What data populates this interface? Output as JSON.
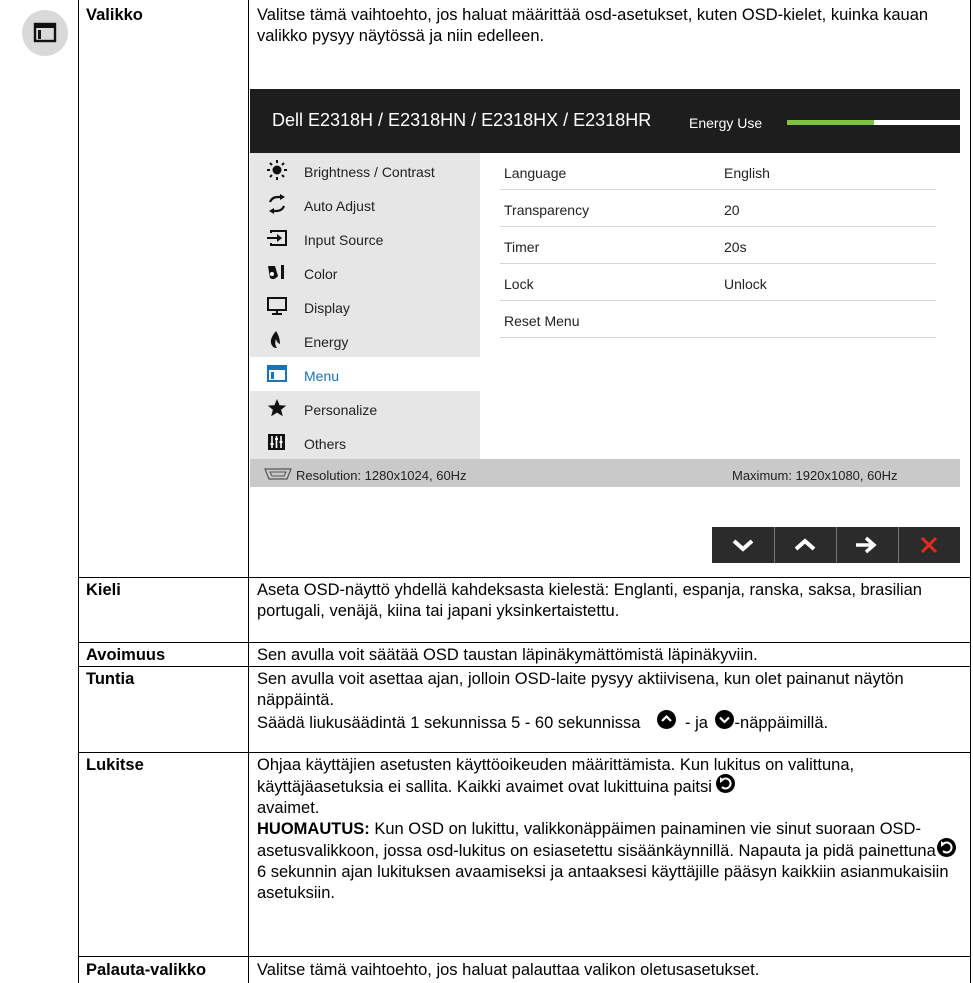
{
  "rows": [
    {
      "label": "Valikko",
      "text": [
        "Valitse tämä vaihtoehto, jos haluat määrittää osd-asetukset, kuten OSD-kielet, kuinka kauan valikko pysyy näytössä ja niin edelleen."
      ]
    },
    {
      "label": "Kieli",
      "text": [
        "Aseta OSD-näyttö yhdellä kahdeksasta kielestä: Englanti, espanja, ranska, saksa, brasilian portugali, venäjä, kiina tai japani yksinkertaistettu."
      ]
    },
    {
      "label": "Avoimuus",
      "text": [
        "Sen avulla voit säätää OSD taustan läpinäkymättömistä läpinäkyviin."
      ]
    },
    {
      "label": "Tuntia",
      "text": [
        "Sen avulla voit asettaa ajan, jolloin OSD-laite pysyy aktiivisena, kun olet painanut näytön näppäintä.",
        "Säädä liukusäädintä 1 sekunnissa 5 - 60 sekunnissa",
        "- ja",
        "-näppäimillä."
      ]
    },
    {
      "label": "Lukitse",
      "text": [
        "Ohjaa käyttäjien asetusten käyttöoikeuden määrittämista. Kun lukitus on valittuna, käyttäjäasetuksia ei sallita. Kaikki avaimet ovat lukittuina paitsi",
        "avaimet.",
        "HUOMAUTUS:",
        "Kun OSD on lukittu, valikkonäppäimen painaminen vie sinut suoraan OSD-asetusvalikkoon, jossa osd-lukitus on esiasetettu sisäänkäynnillä. Napauta ja pidä painettuna",
        "6 sekunnin ajan lukituksen avaamiseksi ja antaaksesi käyttäjille pääsyn kaikkiin asianmukaisiin asetuksiin."
      ]
    },
    {
      "label": "Palauta-valikko",
      "text": [
        "Valitse tämä vaihtoehto, jos haluat palauttaa valikon oletusasetukset."
      ]
    }
  ],
  "osd": {
    "title": "Dell E2318H / E2318HN / E2318HX / E2318HR",
    "energy_label": "Energy Use",
    "energy_level": 0.5,
    "menu": [
      {
        "label": "Brightness / Contrast",
        "icon": "brightness-icon"
      },
      {
        "label": "Auto Adjust",
        "icon": "auto-adjust-icon"
      },
      {
        "label": "Input Source",
        "icon": "input-source-icon"
      },
      {
        "label": "Color",
        "icon": "color-icon"
      },
      {
        "label": "Display",
        "icon": "display-icon"
      },
      {
        "label": "Energy",
        "icon": "energy-icon"
      },
      {
        "label": "Menu",
        "icon": "menu-icon",
        "active": true
      },
      {
        "label": "Personalize",
        "icon": "star-icon"
      },
      {
        "label": "Others",
        "icon": "others-icon"
      }
    ],
    "settings": [
      {
        "name": "Language",
        "value": "English"
      },
      {
        "name": "Transparency",
        "value": "20"
      },
      {
        "name": "Timer",
        "value": "20s"
      },
      {
        "name": "Lock",
        "value": "Unlock"
      },
      {
        "name": "Reset Menu",
        "value": ""
      }
    ],
    "resolution": "Resolution: 1280x1024, 60Hz",
    "maximum": "Maximum: 1920x1080, 60Hz",
    "nav_buttons": [
      "down-arrow-icon",
      "up-arrow-icon",
      "right-arrow-icon",
      "close-icon"
    ],
    "colors": {
      "header": "#1d1d1d",
      "energy": "#7dc243",
      "active": "#1b73b7",
      "close": "#e8281e"
    }
  }
}
